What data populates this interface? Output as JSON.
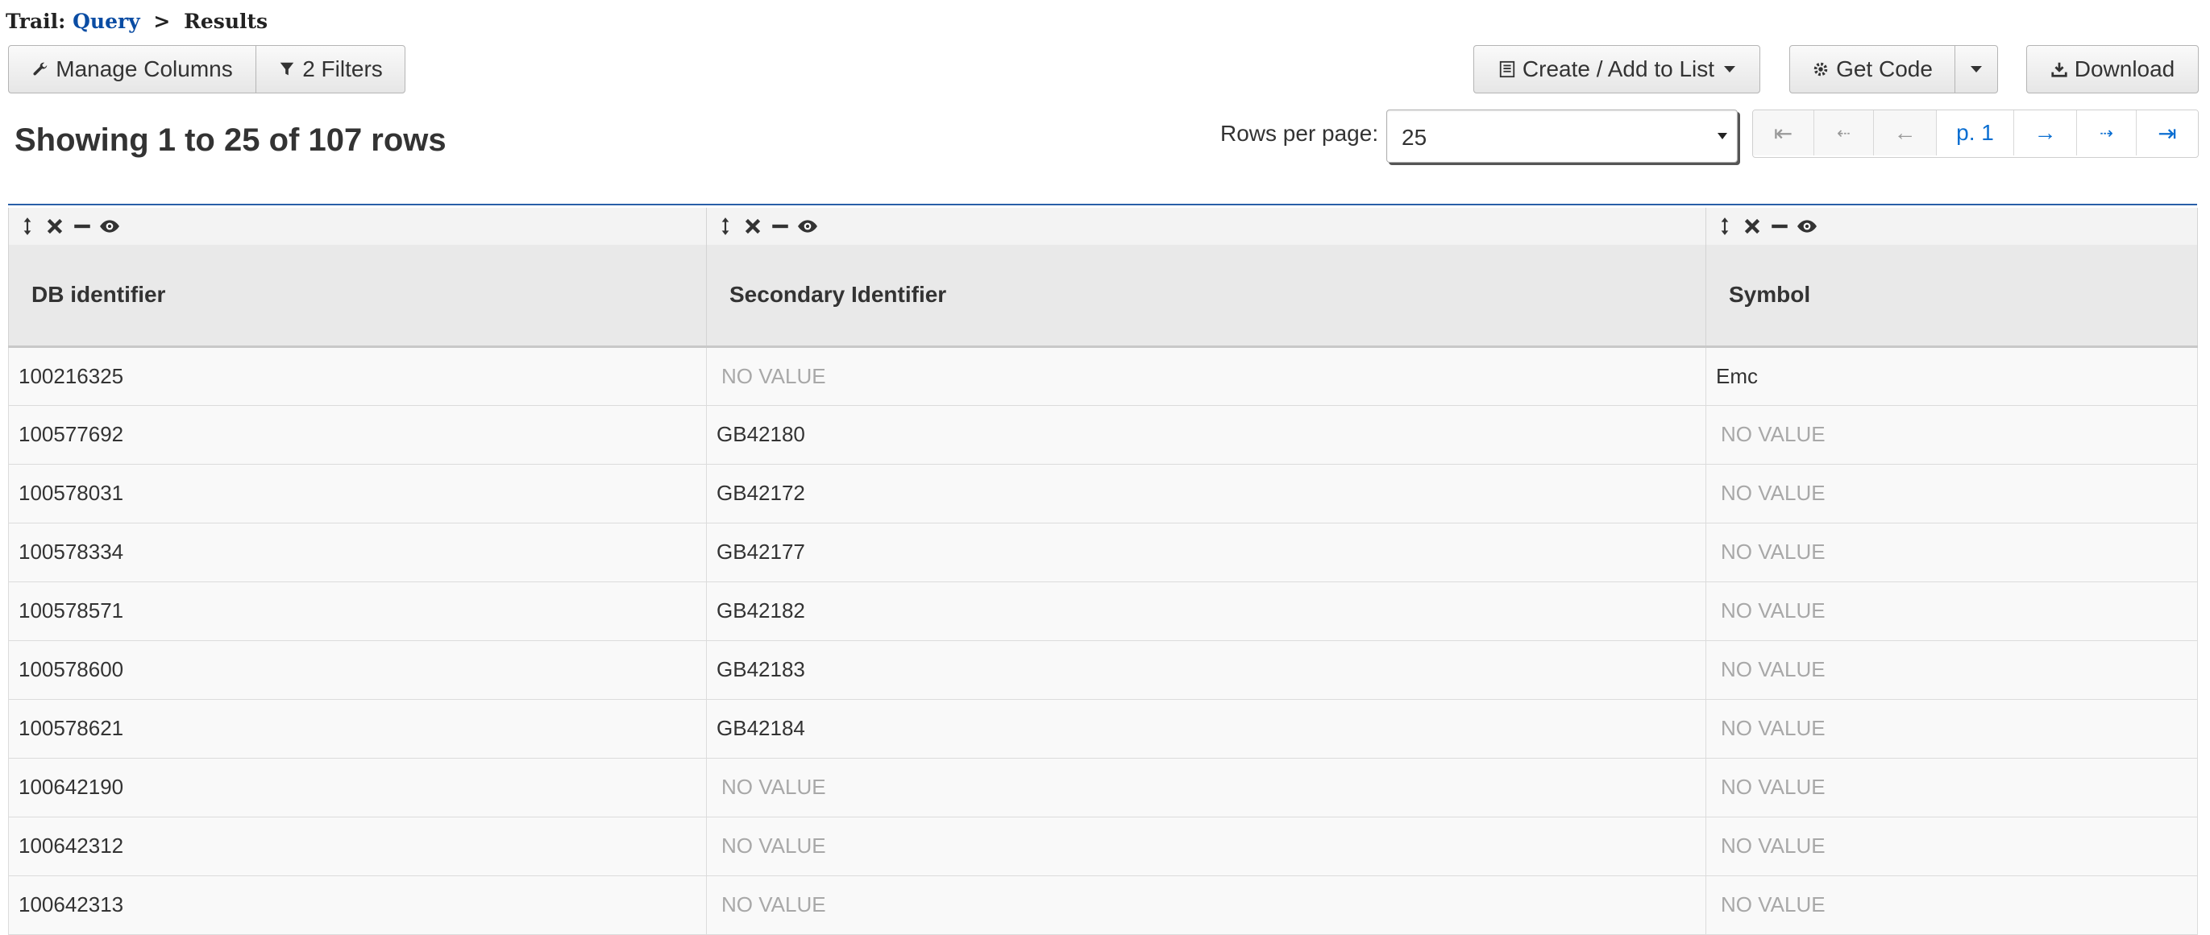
{
  "trail": {
    "label": "Trail:",
    "query_link": "Query",
    "separator": ">",
    "current": "Results"
  },
  "toolbar": {
    "manage_columns": "Manage Columns",
    "filters": "2 Filters",
    "create_add_list": "Create / Add to List",
    "get_code": "Get Code",
    "download": "Download"
  },
  "summary": {
    "showing": "Showing 1 to 25 of 107 rows"
  },
  "pagination": {
    "rows_per_page_label": "Rows per page:",
    "rows_per_page_value": "25",
    "first": "⇤",
    "prev_fast": "⇠",
    "prev": "←",
    "page": "p. 1",
    "next": "→",
    "next_fast": "⇢",
    "last": "⇥"
  },
  "table": {
    "columns": [
      "DB identifier",
      "Secondary Identifier",
      "Symbol"
    ],
    "no_value": "NO VALUE",
    "rows": [
      [
        "100216325",
        "NO VALUE",
        "Emc"
      ],
      [
        "100577692",
        "GB42180",
        "NO VALUE"
      ],
      [
        "100578031",
        "GB42172",
        "NO VALUE"
      ],
      [
        "100578334",
        "GB42177",
        "NO VALUE"
      ],
      [
        "100578571",
        "GB42182",
        "NO VALUE"
      ],
      [
        "100578600",
        "GB42183",
        "NO VALUE"
      ],
      [
        "100578621",
        "GB42184",
        "NO VALUE"
      ],
      [
        "100642190",
        "NO VALUE",
        "NO VALUE"
      ],
      [
        "100642312",
        "NO VALUE",
        "NO VALUE"
      ],
      [
        "100642313",
        "NO VALUE",
        "NO VALUE"
      ]
    ]
  },
  "colors": {
    "link": "#0a4ca3",
    "accent_line": "#2a5fa8",
    "pager_active": "#0a6ed1",
    "no_value": "#a8a8a8"
  }
}
